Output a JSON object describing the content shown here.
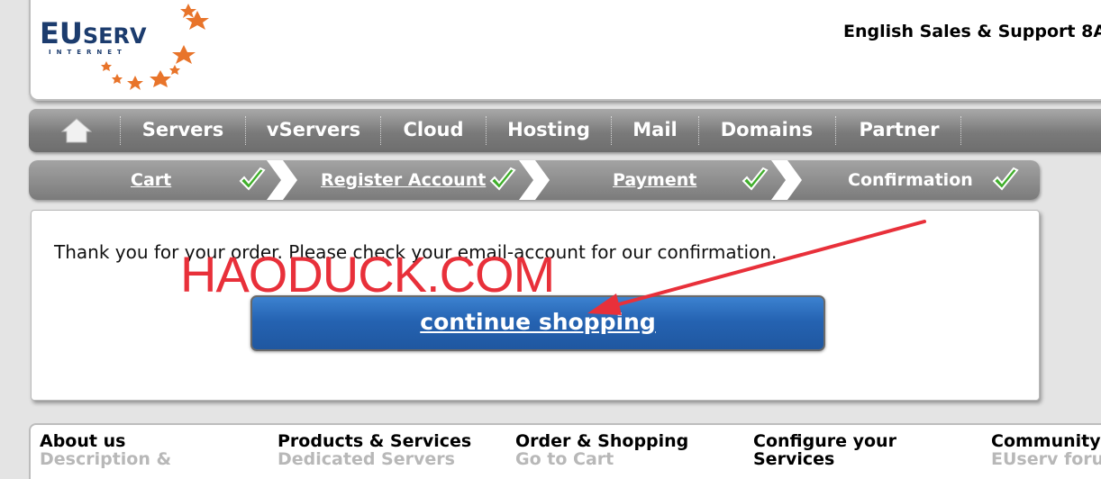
{
  "header": {
    "logo_eu": "EU",
    "logo_serv": "SERV",
    "logo_sub": "INTERNET",
    "support_text": "English Sales & Support 8A"
  },
  "nav": {
    "items": [
      {
        "label": "Servers"
      },
      {
        "label": "vServers"
      },
      {
        "label": "Cloud"
      },
      {
        "label": "Hosting"
      },
      {
        "label": "Mail"
      },
      {
        "label": "Domains"
      },
      {
        "label": "Partner"
      }
    ],
    "home_icon": "home-icon"
  },
  "steps": [
    {
      "label": "Cart",
      "link": true,
      "done": true
    },
    {
      "label": "Register Account",
      "link": true,
      "done": true
    },
    {
      "label": "Payment",
      "link": true,
      "done": true
    },
    {
      "label": "Confirmation",
      "link": false,
      "done": true
    }
  ],
  "content": {
    "message": "Thank you for your order. Please check your email-account for our confirmation.",
    "button_label": "continue shopping"
  },
  "watermark": "HAODUCK.COM",
  "footer": {
    "columns": [
      {
        "heading": "About us",
        "sub": "Description &"
      },
      {
        "heading": "Products & Services",
        "sub": "Dedicated Servers"
      },
      {
        "heading": "Order & Shopping",
        "sub": "Go to Cart"
      },
      {
        "heading": "Configure your",
        "heading2": "Services",
        "sub": ""
      },
      {
        "heading": "Community",
        "sub": "EUserv foru"
      }
    ]
  },
  "colors": {
    "brand_blue": "#1c3c6e",
    "star_orange": "#e8742a",
    "button_blue": "#2563b2",
    "check_green": "#3fae2a",
    "watermark_red": "#e8303a"
  }
}
